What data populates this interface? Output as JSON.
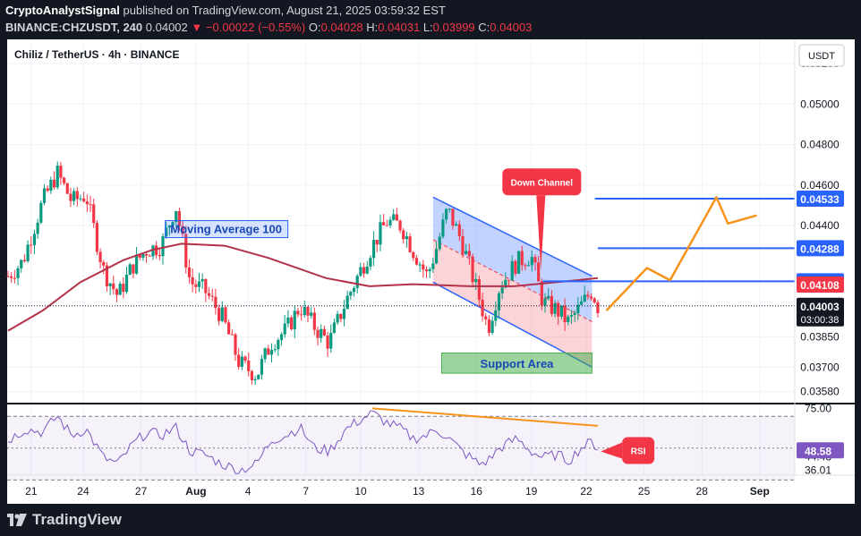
{
  "header": {
    "publisher": "CryptoAnalystSignal",
    "published_text": "published on TradingView.com, August 21, 2025 03:59:32 EST",
    "symbol": "BINANCE:CHZUSDT, 240",
    "last": "0.04002",
    "change": "−0.00022 (−0.55%)",
    "o_label": "O:",
    "o": "0.04028",
    "h_label": "H:",
    "h": "0.04031",
    "l_label": "L:",
    "l": "0.03999",
    "c_label": "C:",
    "c": "0.04003"
  },
  "chart_title": "Chiliz / TetherUS · 4h · BINANCE",
  "currency_button": "USDT",
  "footer": {
    "brand": "TradingView"
  },
  "colors": {
    "bg": "#ffffff",
    "up": "#089981",
    "down": "#f23645",
    "ma": "#b2324a",
    "level": "#2962ff",
    "projection": "#f7931a",
    "rsi": "#7e57c2"
  },
  "chart_data": {
    "type": "candlestick",
    "title": "Chiliz / TetherUS · 4h · BINANCE",
    "y_range": [
      0.0352,
      0.0532
    ],
    "y_ticks": [
      "0.05200",
      "0.05000",
      "0.04800",
      "0.04600",
      "0.04400",
      "0.04000",
      "0.03850",
      "0.03700",
      "0.03580"
    ],
    "y_tick_values": [
      0.052,
      0.05,
      0.048,
      0.046,
      0.044,
      0.04,
      0.0385,
      0.037,
      0.0358
    ],
    "x_ticks": [
      "21",
      "24",
      "27",
      "Aug",
      "4",
      "7",
      "10",
      "13",
      "16",
      "19",
      "22",
      "25",
      "28",
      "Sep"
    ],
    "x_tick_index": [
      8,
      26,
      46,
      65,
      83,
      103,
      122,
      142,
      162,
      181,
      200,
      220,
      240,
      260
    ],
    "candle_count": 180,
    "price_path": [
      [
        0,
        0.0415
      ],
      [
        5,
        0.0422
      ],
      [
        12,
        0.0452
      ],
      [
        17,
        0.0466
      ],
      [
        22,
        0.0452
      ],
      [
        27,
        0.0455
      ],
      [
        33,
        0.0418
      ],
      [
        38,
        0.0405
      ],
      [
        43,
        0.042
      ],
      [
        48,
        0.0428
      ],
      [
        53,
        0.043
      ],
      [
        58,
        0.045
      ],
      [
        63,
        0.0412
      ],
      [
        68,
        0.0408
      ],
      [
        74,
        0.0395
      ],
      [
        80,
        0.0372
      ],
      [
        86,
        0.0366
      ],
      [
        91,
        0.0382
      ],
      [
        96,
        0.0388
      ],
      [
        101,
        0.04
      ],
      [
        106,
        0.039
      ],
      [
        111,
        0.0382
      ],
      [
        117,
        0.0403
      ],
      [
        122,
        0.0418
      ],
      [
        126,
        0.043
      ],
      [
        131,
        0.0442
      ],
      [
        136,
        0.044
      ],
      [
        140,
        0.0428
      ],
      [
        145,
        0.0415
      ],
      [
        148,
        0.0428
      ],
      [
        152,
        0.0448
      ],
      [
        157,
        0.0432
      ],
      [
        163,
        0.0404
      ],
      [
        166,
        0.0389
      ],
      [
        170,
        0.041
      ],
      [
        176,
        0.0422
      ],
      [
        181,
        0.0425
      ],
      [
        185,
        0.0402
      ],
      [
        190,
        0.0398
      ],
      [
        194,
        0.0392
      ],
      [
        198,
        0.04
      ],
      [
        202,
        0.0408
      ],
      [
        204,
        0.04
      ]
    ],
    "ma_label": "Moving Average 100",
    "ma_path": [
      [
        0,
        0.0388
      ],
      [
        12,
        0.0398
      ],
      [
        25,
        0.0412
      ],
      [
        40,
        0.0423
      ],
      [
        50,
        0.0428
      ],
      [
        60,
        0.0431
      ],
      [
        75,
        0.043
      ],
      [
        90,
        0.0424
      ],
      [
        110,
        0.0414
      ],
      [
        125,
        0.041
      ],
      [
        140,
        0.0411
      ],
      [
        160,
        0.041
      ],
      [
        175,
        0.041
      ],
      [
        190,
        0.0412
      ],
      [
        204,
        0.0414
      ]
    ],
    "last_price": {
      "price": "0.04003",
      "value": 0.04003,
      "countdown": "03:00:38"
    },
    "levels": [
      {
        "price": "0.04533",
        "value": 0.04533,
        "from": 203
      },
      {
        "price": "0.04288",
        "value": 0.04288,
        "from": 204
      },
      {
        "price": "0.04124",
        "value": 0.04124,
        "from": 185
      },
      {
        "price": "0.04108",
        "value": 0.04108
      }
    ],
    "annotations": {
      "down_channel": "Down Channel",
      "support_area": "Support Area",
      "rsi_label": "RSI"
    },
    "channel": {
      "upper": [
        [
          147,
          0.0454
        ],
        [
          202,
          0.0415
        ]
      ],
      "lower": [
        [
          147,
          0.0412
        ],
        [
          202,
          0.037
        ]
      ]
    },
    "support_box": {
      "x1": 150,
      "x2": 202,
      "y1": 0.0377,
      "y2": 0.0367
    },
    "projection": [
      [
        207,
        0.0398
      ],
      [
        221,
        0.0419
      ],
      [
        229,
        0.0413
      ],
      [
        245,
        0.0454
      ],
      [
        249,
        0.0441
      ],
      [
        259,
        0.0445
      ]
    ],
    "rsi": {
      "range": [
        33,
        78
      ],
      "ticks": [
        "75.00",
        "44.43",
        "36.01"
      ],
      "tick_values": [
        75,
        44.43,
        36.01
      ],
      "levels": [
        70,
        30
      ],
      "value": "48.58",
      "value_num": 48.58,
      "path": [
        [
          0,
          55
        ],
        [
          6,
          62
        ],
        [
          12,
          60
        ],
        [
          17,
          70
        ],
        [
          22,
          58
        ],
        [
          27,
          62
        ],
        [
          33,
          44
        ],
        [
          38,
          40
        ],
        [
          43,
          52
        ],
        [
          48,
          60
        ],
        [
          53,
          58
        ],
        [
          58,
          63
        ],
        [
          63,
          48
        ],
        [
          68,
          46
        ],
        [
          74,
          40
        ],
        [
          80,
          36
        ],
        [
          86,
          40
        ],
        [
          91,
          55
        ],
        [
          96,
          58
        ],
        [
          101,
          63
        ],
        [
          106,
          50
        ],
        [
          111,
          48
        ],
        [
          117,
          62
        ],
        [
          122,
          68
        ],
        [
          126,
          72
        ],
        [
          131,
          66
        ],
        [
          136,
          62
        ],
        [
          140,
          56
        ],
        [
          145,
          58
        ],
        [
          148,
          62
        ],
        [
          152,
          57
        ],
        [
          157,
          48
        ],
        [
          163,
          40
        ],
        [
          166,
          42
        ],
        [
          170,
          50
        ],
        [
          176,
          56
        ],
        [
          181,
          48
        ],
        [
          185,
          44
        ],
        [
          190,
          46
        ],
        [
          194,
          42
        ],
        [
          198,
          50
        ],
        [
          202,
          54
        ],
        [
          204,
          50
        ]
      ],
      "divergence": [
        [
          126,
          75
        ],
        [
          204,
          64
        ]
      ]
    }
  }
}
